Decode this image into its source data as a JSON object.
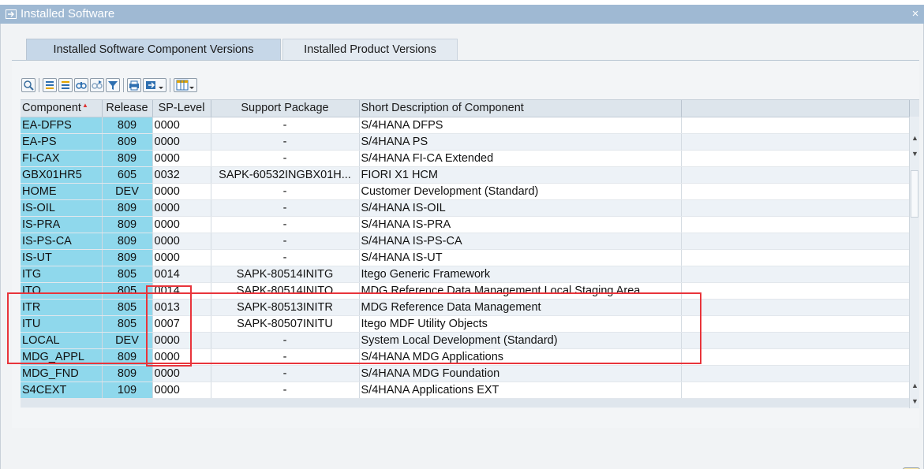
{
  "window": {
    "title": "Installed Software",
    "close_symbol": "×"
  },
  "tabs": [
    {
      "label": "Installed Software Component Versions",
      "active": true
    },
    {
      "label": "Installed Product Versions",
      "active": false
    }
  ],
  "toolbar": {
    "icons": [
      "details-icon",
      "sort-ascending-icon",
      "sort-descending-icon",
      "find-icon",
      "find-next-icon",
      "filter-icon",
      "print-icon",
      "export-icon",
      "layout-icon"
    ]
  },
  "grid": {
    "columns": [
      "Component",
      "Release",
      "SP-Level",
      "Support Package",
      "Short Description of Component"
    ],
    "rows": [
      {
        "component": "EA-DFPS",
        "release": "809",
        "sp_level": "0000",
        "support_package": "-",
        "description": "S/4HANA DFPS"
      },
      {
        "component": "EA-PS",
        "release": "809",
        "sp_level": "0000",
        "support_package": "-",
        "description": "S/4HANA PS"
      },
      {
        "component": "FI-CAX",
        "release": "809",
        "sp_level": "0000",
        "support_package": "-",
        "description": "S/4HANA FI-CA Extended"
      },
      {
        "component": "GBX01HR5",
        "release": "605",
        "sp_level": "0032",
        "support_package": "SAPK-60532INGBX01H...",
        "description": "FIORI X1 HCM"
      },
      {
        "component": "HOME",
        "release": "DEV",
        "sp_level": "0000",
        "support_package": "-",
        "description": "Customer Development (Standard)"
      },
      {
        "component": "IS-OIL",
        "release": "809",
        "sp_level": "0000",
        "support_package": "-",
        "description": "S/4HANA IS-OIL"
      },
      {
        "component": "IS-PRA",
        "release": "809",
        "sp_level": "0000",
        "support_package": "-",
        "description": "S/4HANA IS-PRA"
      },
      {
        "component": "IS-PS-CA",
        "release": "809",
        "sp_level": "0000",
        "support_package": "-",
        "description": "S/4HANA IS-PS-CA"
      },
      {
        "component": "IS-UT",
        "release": "809",
        "sp_level": "0000",
        "support_package": "-",
        "description": "S/4HANA IS-UT"
      },
      {
        "component": "ITG",
        "release": "805",
        "sp_level": "0014",
        "support_package": "SAPK-80514INITG",
        "description": "Itego Generic Framework"
      },
      {
        "component": "ITO",
        "release": "805",
        "sp_level": "0014",
        "support_package": "SAPK-80514INITO",
        "description": "MDG Reference Data Management Local Staging Area"
      },
      {
        "component": "ITR",
        "release": "805",
        "sp_level": "0013",
        "support_package": "SAPK-80513INITR",
        "description": "MDG Reference Data Management"
      },
      {
        "component": "ITU",
        "release": "805",
        "sp_level": "0007",
        "support_package": "SAPK-80507INITU",
        "description": "Itego MDF Utility Objects"
      },
      {
        "component": "LOCAL",
        "release": "DEV",
        "sp_level": "0000",
        "support_package": "-",
        "description": "System Local Development (Standard)"
      },
      {
        "component": "MDG_APPL",
        "release": "809",
        "sp_level": "0000",
        "support_package": "-",
        "description": "S/4HANA MDG Applications"
      },
      {
        "component": "MDG_FND",
        "release": "809",
        "sp_level": "0000",
        "support_package": "-",
        "description": "S/4HANA MDG Foundation"
      },
      {
        "component": "S4CEXT",
        "release": "109",
        "sp_level": "0000",
        "support_package": "-",
        "description": "S/4HANA Applications EXT"
      }
    ]
  },
  "colors": {
    "titlebar": "#9fb9d3",
    "key_column": "#8fd8ec",
    "highlight": "#e8343b",
    "ok_button": "#fbe7a4"
  }
}
